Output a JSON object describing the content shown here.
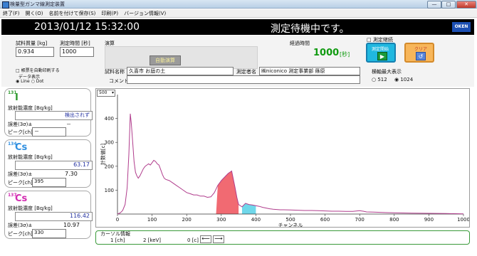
{
  "window": {
    "title": "検量型ガンマ線測定装置",
    "min": "—",
    "max": "□",
    "close": "✕"
  },
  "menu": [
    "終了(F)",
    "開く(O)",
    "名前を付けて保存(S)",
    "印刷(P)",
    "バージョン情報(V)"
  ],
  "header": {
    "datetime": "2013/01/12 15:32:00",
    "status": "測定待機中です。",
    "logo": "OKEN"
  },
  "inputs": {
    "mass_label": "試料質量 [kg]",
    "mass_value": "0.934",
    "time_label": "測定時間 [秒]",
    "time_value": "1000",
    "calc_label": "演算",
    "auto_button": "自動演算",
    "elapsed_label": "経過時間",
    "elapsed_value": "1000",
    "elapsed_unit": "[秒]"
  },
  "controls": {
    "continuous": "測定継続",
    "start": "測定開始",
    "clear": "クリア",
    "max_label": "横軸最大表示",
    "opt512": "512",
    "opt1024": "1024"
  },
  "options": {
    "autoprint": "帳票を自動印刷する",
    "display_label": "データ表示",
    "line": "Line",
    "dot": "Dot"
  },
  "sample": {
    "name_label": "試料名称",
    "name_value": "久喜市 お庭の土",
    "measurer_label": "測定者名",
    "measurer_value": "㈱niconico 測定事業部 篠原",
    "comment_label": "コメント",
    "comment_value": ""
  },
  "nuclides": [
    {
      "mass": "131",
      "symbol": "I",
      "conc_label": "放射能濃度 [Bq/kg]",
      "value": "検出されず",
      "err_label": "誤差(3σ)±",
      "err_value": "－",
      "peak_label": "ピーク[ch]",
      "peak_value": "－",
      "color": "#2f9a2f"
    },
    {
      "mass": "134",
      "symbol": "Cs",
      "conc_label": "放射能濃度 [Bq/kg]",
      "value": "63.17",
      "err_label": "誤差(3σ)±",
      "err_value": "7.30",
      "peak_label": "ピーク[ch]",
      "peak_value": "395",
      "color": "#2f8fe0"
    },
    {
      "mass": "137",
      "symbol": "Cs",
      "conc_label": "放射能濃度 [Bq/kg]",
      "value": "116.42",
      "err_label": "誤差(3σ)±",
      "err_value": "10.97",
      "peak_label": "ピーク[ch]",
      "peak_value": "330",
      "color": "#d22ab0"
    }
  ],
  "cursor": {
    "title": "カーソル情報",
    "ch": "1 [ch]",
    "kev": "2 [keV]",
    "count": "0 [c]",
    "left": "⟵",
    "right": "⟶"
  },
  "chart_data": {
    "type": "line",
    "ylim_select": "500",
    "xlabel": "チャンネル",
    "ylabel": "計数値[c]",
    "xlim": [
      0,
      1000
    ],
    "ylim": [
      0,
      500
    ],
    "xticks": [
      0,
      100,
      200,
      300,
      400,
      500,
      600,
      700,
      800,
      900,
      1000
    ],
    "yticks": [
      100,
      200,
      300,
      400
    ],
    "grid": false,
    "line_color": "#b03c8c",
    "series": [
      {
        "x": [
          0,
          8,
          15,
          22,
          28,
          33,
          37,
          40,
          44,
          48,
          52,
          56,
          60,
          65,
          70,
          75,
          80,
          85,
          90,
          95,
          100,
          105,
          110,
          115,
          120,
          125,
          130,
          135,
          140,
          150,
          160,
          170,
          180,
          190,
          200,
          210,
          220,
          230,
          240,
          250,
          260,
          270,
          280,
          290,
          300,
          310,
          320,
          330,
          340,
          345,
          350,
          360,
          370,
          380,
          390,
          400,
          410,
          420,
          430,
          440,
          450,
          460,
          470,
          480,
          500,
          520,
          540,
          560,
          580,
          600,
          620,
          640,
          660,
          680,
          700,
          710,
          720,
          740,
          760,
          780,
          800,
          850,
          900,
          950,
          1000
        ],
        "y": [
          0,
          5,
          15,
          40,
          110,
          250,
          420,
          380,
          300,
          220,
          175,
          160,
          150,
          160,
          175,
          190,
          200,
          205,
          210,
          205,
          215,
          225,
          220,
          210,
          205,
          185,
          165,
          150,
          145,
          140,
          130,
          120,
          110,
          100,
          90,
          85,
          80,
          80,
          75,
          75,
          70,
          72,
          90,
          120,
          140,
          155,
          170,
          180,
          110,
          70,
          40,
          30,
          45,
          40,
          38,
          35,
          32,
          28,
          25,
          22,
          20,
          19,
          18,
          18,
          17,
          16,
          15,
          15,
          14,
          13,
          12,
          12,
          11,
          11,
          14,
          12,
          9,
          8,
          7,
          6,
          5,
          4,
          3,
          2,
          1
        ]
      }
    ],
    "highlights": [
      {
        "name": "137Cs",
        "from": 285,
        "to": 350,
        "color": "#f05a63"
      },
      {
        "name": "134Cs",
        "from": 360,
        "to": 400,
        "color": "#5fd3e8"
      }
    ]
  }
}
